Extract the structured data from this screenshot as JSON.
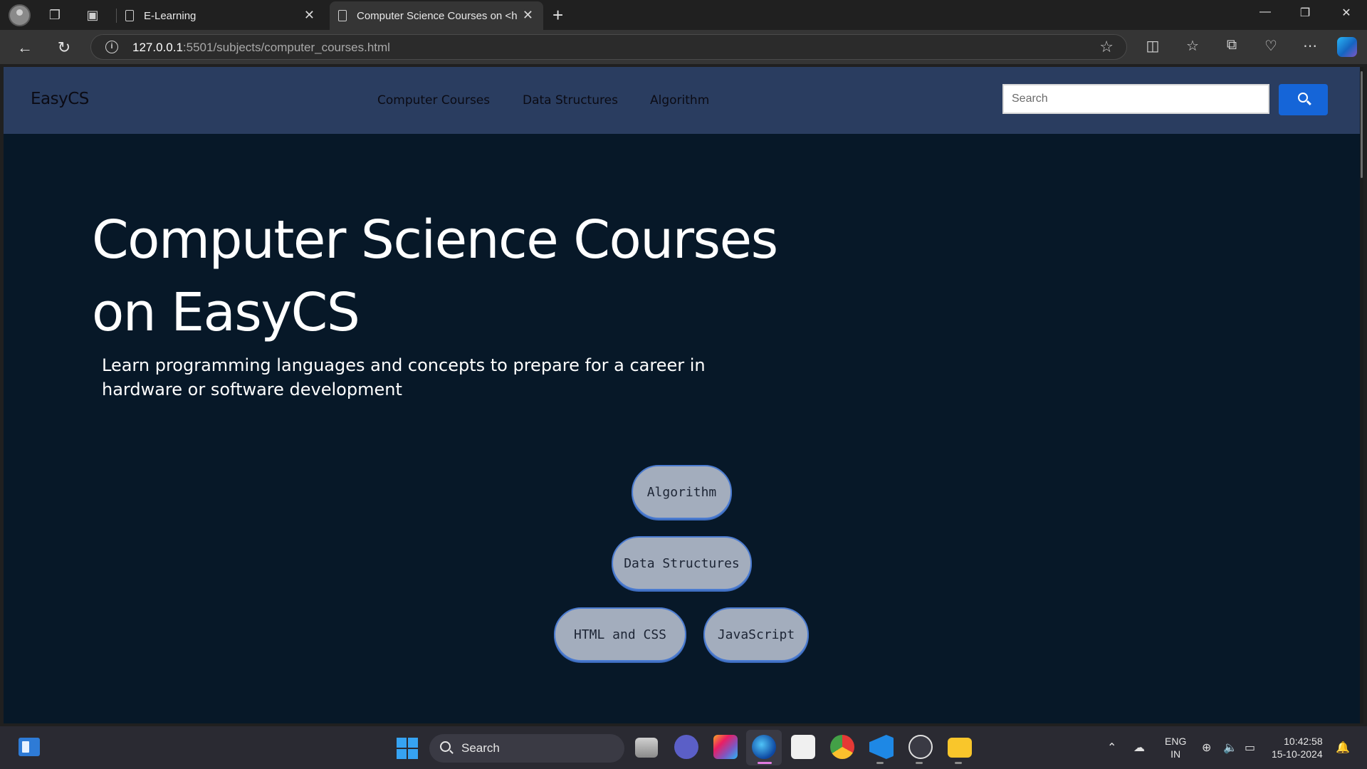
{
  "browser": {
    "tabs": [
      {
        "title": "E-Learning",
        "active": false
      },
      {
        "title": "Computer Science Courses on <h",
        "active": true
      }
    ],
    "address": {
      "host": "127.0.0.1",
      "path": ":5501/subjects/computer_courses.html"
    },
    "icons": [
      "profile-icon",
      "workspaces-icon",
      "tab-actions-icon",
      "back-icon",
      "reload-icon",
      "info-icon",
      "favorite-star-icon",
      "split-screen-icon",
      "favorites-icon",
      "collections-icon",
      "browser-essentials-icon",
      "more-icon",
      "copilot-icon"
    ]
  },
  "site": {
    "brand": "EasyCS",
    "nav": [
      "Computer Courses",
      "Data Structures",
      "Algorithm"
    ],
    "search": {
      "placeholder": "Search",
      "value": ""
    },
    "hero": {
      "title": "Computer Science Courses on EasyCS",
      "subtitle": "Learn programming languages and concepts to prepare for a career in hardware or software development"
    },
    "courses": [
      "Algorithm",
      "Data Structures",
      "HTML and CSS",
      "JavaScript"
    ]
  },
  "taskbar": {
    "search_label": "Search",
    "lang": {
      "line1": "ENG",
      "line2": "IN"
    },
    "time": "10:42:58",
    "date": "15-10-2024"
  },
  "colors": {
    "page_bg": "#071828",
    "header_bg": "#2a3d60",
    "search_button": "#1565d8",
    "course_button": "#a3adbd"
  }
}
